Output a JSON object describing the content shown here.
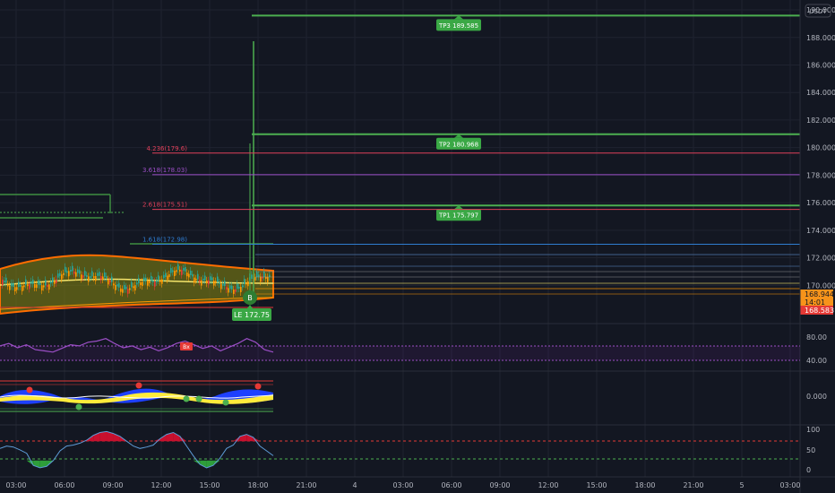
{
  "header": {
    "currency": "USDT"
  },
  "colors": {
    "bg": "#131722",
    "grid": "#1f2330",
    "axis_text": "#b2b5be",
    "tp_green": "#4caf50",
    "fib_red": "#e0405a",
    "fib_purple": "#9c4fc7",
    "fib_blue": "#2f7dd1",
    "price_badge": "#f7931a",
    "low_badge": "#e53935",
    "rsi_purple": "#8e44ad"
  },
  "chart_data": [
    {
      "type": "line",
      "panel": "price",
      "x_ticks": [
        "03:00",
        "06:00",
        "09:00",
        "12:00",
        "15:00",
        "18:00",
        "21:00",
        "4",
        "03:00",
        "06:00",
        "09:00",
        "12:00",
        "15:00",
        "18:00",
        "21:00",
        "5",
        "03:00"
      ],
      "y_ticks": [
        "190.000",
        "188.000",
        "186.000",
        "184.000",
        "182.000",
        "180.000",
        "178.000",
        "176.000",
        "174.000",
        "172.000",
        "170.000"
      ],
      "ylim": [
        168,
        191.5
      ],
      "levels": [
        {
          "name": "tp3",
          "label": "TP3 189.585",
          "value": 189.585,
          "role": "tp"
        },
        {
          "name": "tp2",
          "label": "TP2 180.968",
          "value": 180.968,
          "role": "tp"
        },
        {
          "name": "tp1",
          "label": "TP1 175.797",
          "value": 175.797,
          "role": "tp"
        },
        {
          "name": "fib-4236",
          "label": "4.236(179.6)",
          "value": 179.6,
          "role": "fib-red"
        },
        {
          "name": "fib-3618",
          "label": "3.618(178.03)",
          "value": 178.03,
          "role": "fib-purple"
        },
        {
          "name": "fib-2618",
          "label": "2.618(175.51)",
          "value": 175.51,
          "role": "fib-red"
        },
        {
          "name": "fib-1618",
          "label": "1.618(172.98)",
          "value": 172.98,
          "role": "fib-blue"
        }
      ],
      "entry": {
        "label": "LE 172.75",
        "marker": "B"
      },
      "price_badges": [
        {
          "name": "last-price",
          "label": "168.944",
          "value": 168.944
        },
        {
          "name": "countdown",
          "label": "14:01",
          "value": 168.75
        },
        {
          "name": "low-price",
          "label": "168.583",
          "value": 168.583
        }
      ]
    },
    {
      "type": "line",
      "panel": "rsi",
      "y_ticks": [
        "80.00",
        "40.00"
      ],
      "tag": "Bx",
      "series": [
        {
          "values": [
            58,
            62,
            55,
            60,
            52,
            50,
            48,
            54,
            60,
            58,
            64,
            66,
            70,
            62,
            55,
            58,
            52,
            56,
            50,
            55,
            62,
            66,
            60,
            54,
            58,
            50,
            56,
            62,
            70,
            64,
            52,
            48
          ]
        }
      ]
    },
    {
      "type": "area",
      "panel": "wave",
      "y_ticks": [
        "0.000"
      ]
    },
    {
      "type": "area",
      "panel": "oscillator",
      "y_ticks": [
        "100",
        "50",
        "0"
      ],
      "series": [
        {
          "values": [
            55,
            60,
            58,
            52,
            45,
            20,
            15,
            18,
            30,
            50,
            60,
            62,
            66,
            72,
            82,
            88,
            90,
            86,
            80,
            70,
            60,
            55,
            58,
            62,
            75,
            84,
            88,
            80,
            60,
            40,
            22,
            15,
            20,
            35,
            55,
            62,
            80,
            84,
            78,
            60,
            50,
            40
          ]
        }
      ]
    }
  ]
}
